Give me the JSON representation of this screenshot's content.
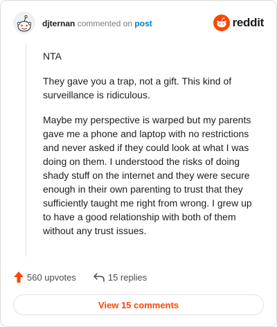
{
  "header": {
    "username": "djternan",
    "action_text": "commented on",
    "post_link": "post",
    "brand": "reddit"
  },
  "comment": {
    "paragraphs": [
      "NTA",
      "They gave you a trap, not a gift. This kind of surveillance is ridiculous.",
      "Maybe my perspective is warped but my parents gave me a phone and laptop with no restrictions and never asked if they could look at what I was doing on them. I understood the risks of doing shady stuff on the internet and they were secure enough in their own parenting to trust that they sufficiently taught me right from wrong. I grew up to have a good relationship with both of them without any trust issues."
    ]
  },
  "actions": {
    "upvotes": "560 upvotes",
    "replies": "15 replies",
    "upvote_icon": "upvote-arrow-icon",
    "reply_icon": "reply-arrow-icon"
  },
  "footer": {
    "view_comments": "View 15 comments"
  },
  "colors": {
    "accent": "#ff4500",
    "link": "#0079d3",
    "text": "#1c1c1c",
    "muted": "#7c7c7c"
  }
}
